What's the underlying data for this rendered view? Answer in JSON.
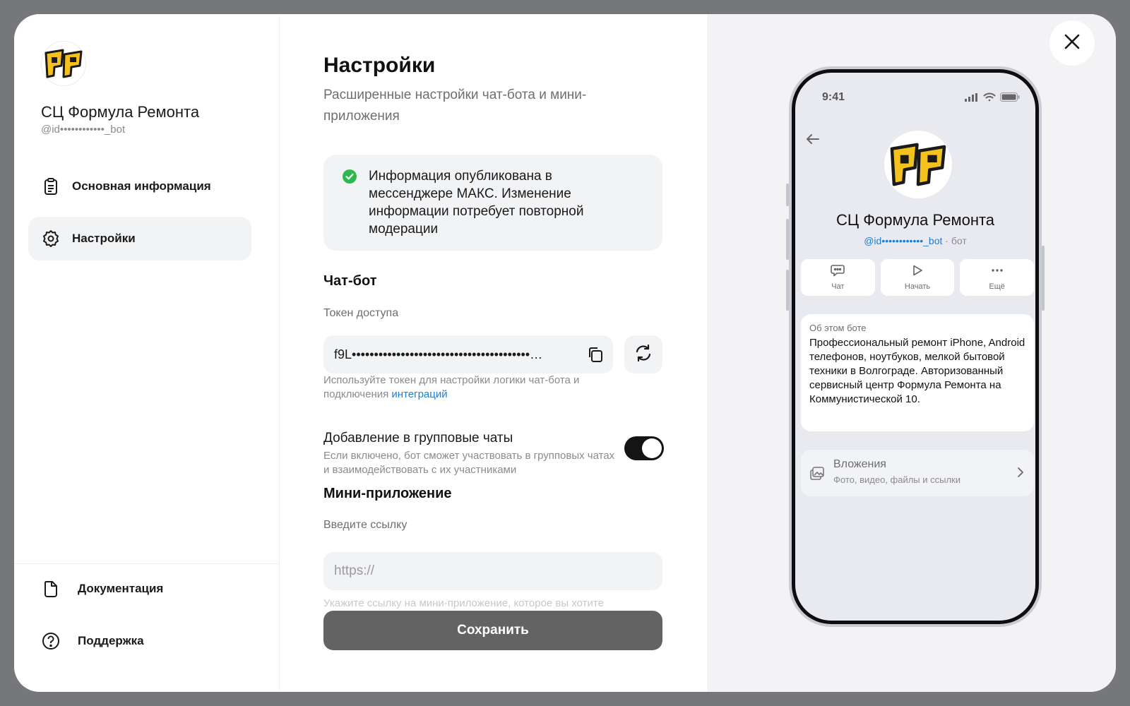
{
  "sidebar": {
    "brand_name": "СЦ Формула Ремонта",
    "brand_handle": "@id••••••••••••_bot",
    "nav": [
      {
        "label": "Основная информация",
        "icon": "clipboard-icon"
      },
      {
        "label": "Настройки",
        "icon": "gear-icon",
        "active": true
      }
    ],
    "bottom": [
      {
        "label": "Документация",
        "icon": "document-icon"
      },
      {
        "label": "Поддержка",
        "icon": "help-circle-icon"
      }
    ]
  },
  "main": {
    "title": "Настройки",
    "subtitle": "Расширенные настройки чат-бота и мини-приложения",
    "notice": "Информация опубликована в мессенджере МАКС. Изменение информации потребует повторной модерации",
    "chatbot": {
      "heading": "Чат-бот",
      "token_label": "Токен доступа",
      "token_value": "f9L••••••••••••••••••••••••••••••••••••••••…",
      "token_hint": "Используйте токен для настройки логики чат-бота и подключения ",
      "token_hint_link": "интеграций",
      "group_title": "Добавление в групповые чаты",
      "group_hint": "Если включено, бот сможет участвовать в групповых чатах и взаимодействовать с их участниками",
      "group_enabled": true
    },
    "miniapp": {
      "heading": "Мини-приложение",
      "link_label": "Введите ссылку",
      "link_placeholder": "https://",
      "link_value": "",
      "link_hint": "Укажите ссылку на мини-приложение, которое вы хотите"
    },
    "save_label": "Сохранить"
  },
  "preview": {
    "time": "9:41",
    "bot_name": "СЦ Формула Ремонта",
    "handle": "@id••••••••••••_bot",
    "handle_suffix": " · бот",
    "actions": [
      {
        "label": "Чат",
        "icon": "chat-icon"
      },
      {
        "label": "Начать",
        "icon": "play-icon"
      },
      {
        "label": "Ещё",
        "icon": "more-icon"
      }
    ],
    "about_heading": "Об этом боте",
    "about_text": "Профессиональный ремонт iPhone, Android телефонов, ноутбуков, мелкой бытовой техники в Волгограде. Авторизованный сервисный центр Формула Ремонта на Коммунистической 10.",
    "attachments_title": "Вложения",
    "attachments_subtitle": "Фото, видео, файлы и ссылки"
  },
  "colors": {
    "accent_link": "#1c7ed6",
    "success": "#2fb84f",
    "logo_yellow": "#f4c21f",
    "toggle_on": "#141414",
    "save_button": "#636363"
  }
}
